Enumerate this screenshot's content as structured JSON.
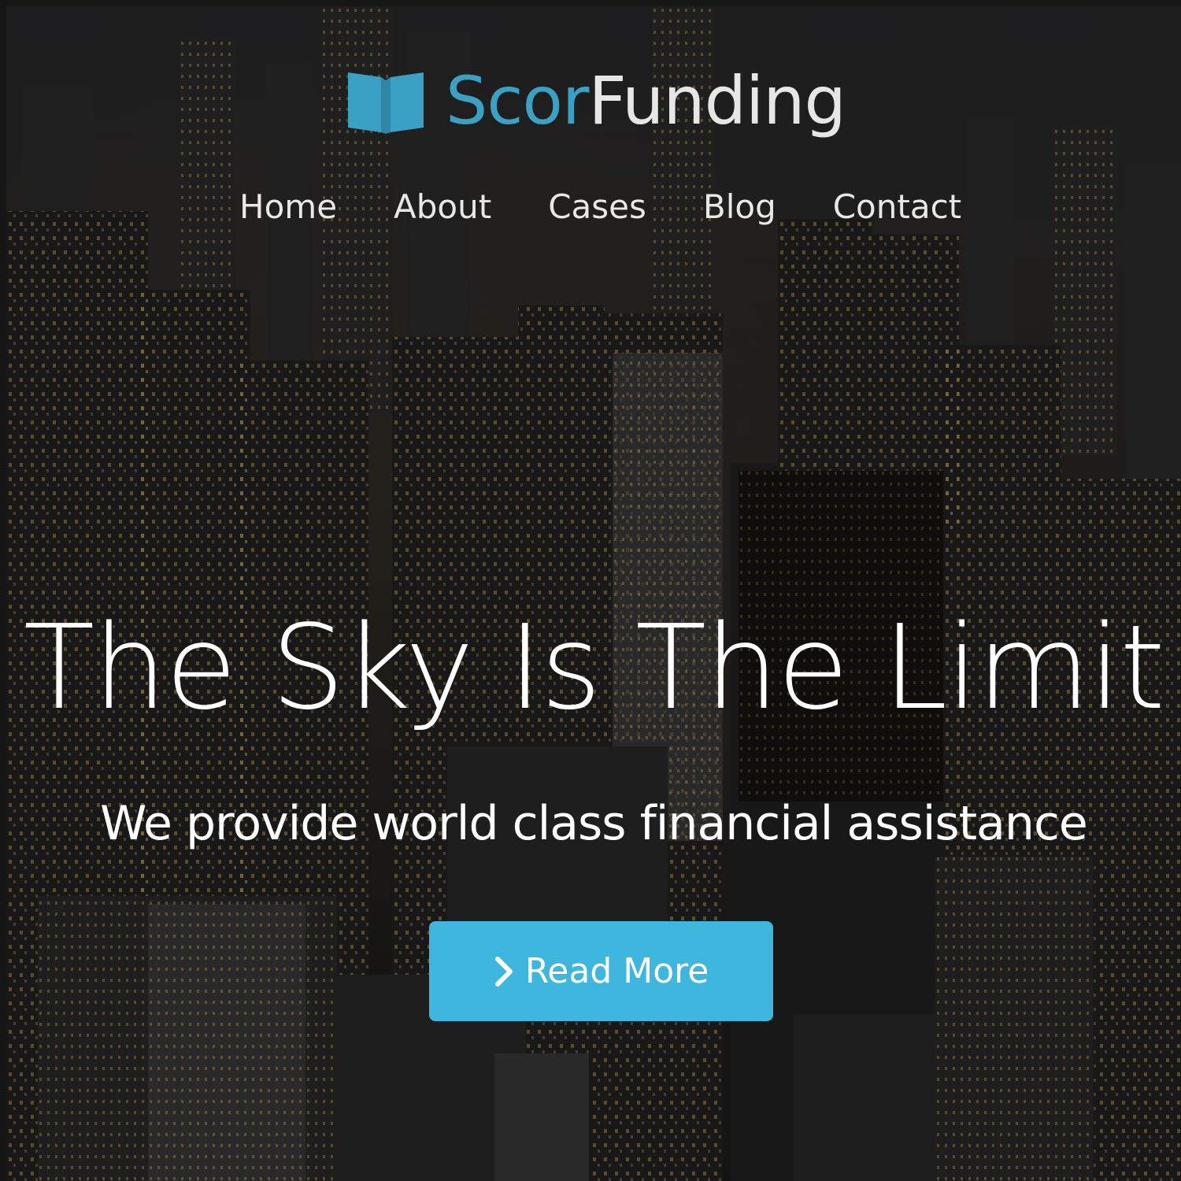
{
  "brand": {
    "name_accent": "Scor",
    "name_rest": "Funding",
    "logo_icon": "open-book-icon",
    "accent_color": "#3aa0c4"
  },
  "nav": {
    "items": [
      {
        "label": "Home"
      },
      {
        "label": "About"
      },
      {
        "label": "Cases"
      },
      {
        "label": "Blog"
      },
      {
        "label": "Contact"
      }
    ]
  },
  "hero": {
    "headline": "The Sky Is The Limit",
    "subheadline": "We provide world class financial assistance",
    "background_image": "night-city-skyline-image",
    "cta": {
      "label": "Read More",
      "icon": "chevron-right-icon",
      "color": "#3fb6dd"
    }
  }
}
